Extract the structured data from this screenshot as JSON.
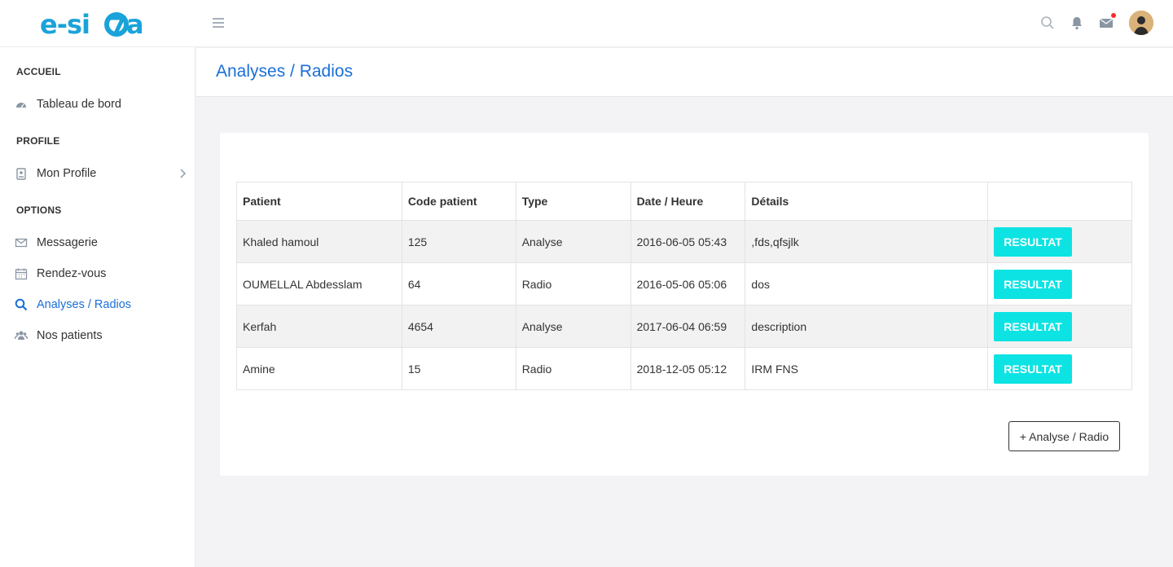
{
  "brand": {
    "logo_text": "e-sioa",
    "color": "#1aa3d9"
  },
  "header": {
    "icons": [
      "menu-icon",
      "search-icon",
      "bell-icon",
      "mail-icon",
      "avatar"
    ]
  },
  "sidebar": {
    "sections": [
      {
        "title": "ACCUEIL",
        "items": [
          {
            "label": "Tableau de bord",
            "icon": "dashboard-icon"
          }
        ]
      },
      {
        "title": "PROFILE",
        "items": [
          {
            "label": "Mon Profile",
            "icon": "id-badge-icon"
          }
        ]
      },
      {
        "title": "OPTIONS",
        "items": [
          {
            "label": "Messagerie",
            "icon": "envelope-icon"
          },
          {
            "label": "Rendez-vous",
            "icon": "calendar-icon"
          },
          {
            "label": "Analyses / Radios",
            "icon": "search-icon",
            "active": true
          },
          {
            "label": "Nos patients",
            "icon": "users-icon"
          }
        ]
      }
    ]
  },
  "page": {
    "title": "Analyses / Radios"
  },
  "table": {
    "headers": [
      "Patient",
      "Code patient",
      "Type",
      "Date / Heure",
      "Détails",
      ""
    ],
    "rows": [
      {
        "patient": "Khaled hamoul",
        "code": "125",
        "type": "Analyse",
        "date": "2016-06-05 05:43",
        "details": ",fds,qfsjlk",
        "action": "RESULTAT"
      },
      {
        "patient": "OUMELLAL Abdesslam",
        "code": "64",
        "type": "Radio",
        "date": "2016-05-06 05:06",
        "details": "dos",
        "action": "RESULTAT"
      },
      {
        "patient": "Kerfah",
        "code": "4654",
        "type": "Analyse",
        "date": "2017-06-04 06:59",
        "details": "description",
        "action": "RESULTAT"
      },
      {
        "patient": "Amine",
        "code": "15",
        "type": "Radio",
        "date": "2018-12-05 05:12",
        "details": "IRM FNS",
        "action": "RESULTAT"
      }
    ]
  },
  "actions": {
    "add_label": "+ Analyse / Radio"
  },
  "colors": {
    "accent": "#1a6fd8",
    "button": "#0ee3e3",
    "notification": "#ff2a2a"
  }
}
